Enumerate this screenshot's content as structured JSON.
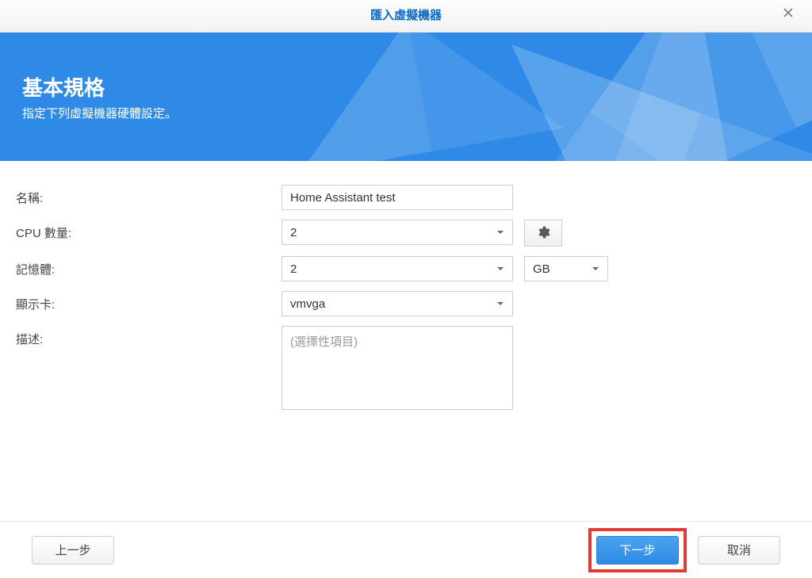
{
  "dialog": {
    "title": "匯入虛擬機器"
  },
  "banner": {
    "heading": "基本規格",
    "subheading": "指定下列虛擬機器硬體設定。"
  },
  "form": {
    "name_label": "名稱:",
    "name_value": "Home Assistant test",
    "cpu_label": "CPU 數量:",
    "cpu_value": "2",
    "memory_label": "記憶體:",
    "memory_value": "2",
    "memory_unit_value": "GB",
    "gpu_label": "顯示卡:",
    "gpu_value": "vmvga",
    "description_label": "描述:",
    "description_placeholder": "(選擇性項目)",
    "description_value": ""
  },
  "footer": {
    "back_label": "上一步",
    "next_label": "下一步",
    "cancel_label": "取消"
  }
}
